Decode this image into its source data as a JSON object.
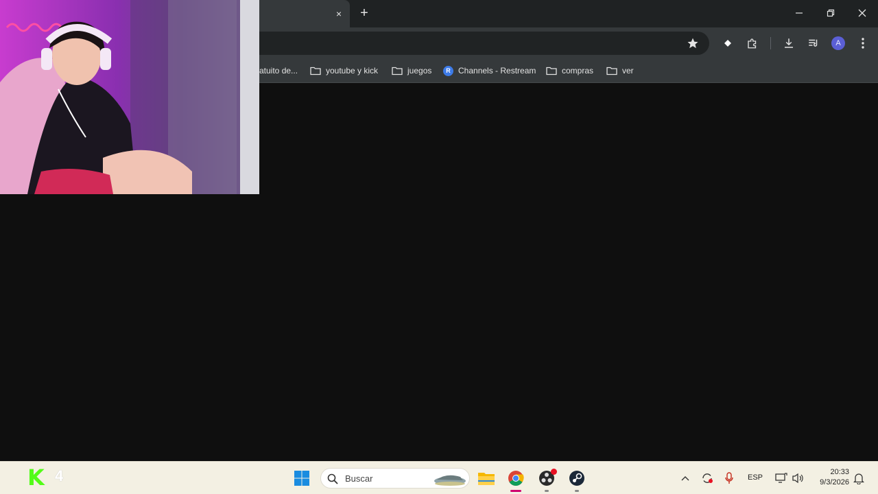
{
  "browser": {
    "bookmarks": [
      {
        "label": "atuito de...",
        "kind": "partial"
      },
      {
        "label": "youtube y kick",
        "kind": "folder"
      },
      {
        "label": "juegos",
        "kind": "folder"
      },
      {
        "label": "Channels - Restream",
        "kind": "restream"
      },
      {
        "label": "compras",
        "kind": "folder"
      },
      {
        "label": "ver",
        "kind": "folder"
      }
    ],
    "profile_initial": "A",
    "tab_close_symbol": "×",
    "new_tab_symbol": "+"
  },
  "taskbar": {
    "widget_logo": "K",
    "widget_count": "4",
    "search_placeholder": "Buscar",
    "language": "ESP",
    "time": "20:33",
    "date": "9/3/2026"
  },
  "colors": {
    "accent_kick": "#53fc18",
    "chrome_bg": "#35393b",
    "taskbar_bg": "#f3f0e3"
  }
}
